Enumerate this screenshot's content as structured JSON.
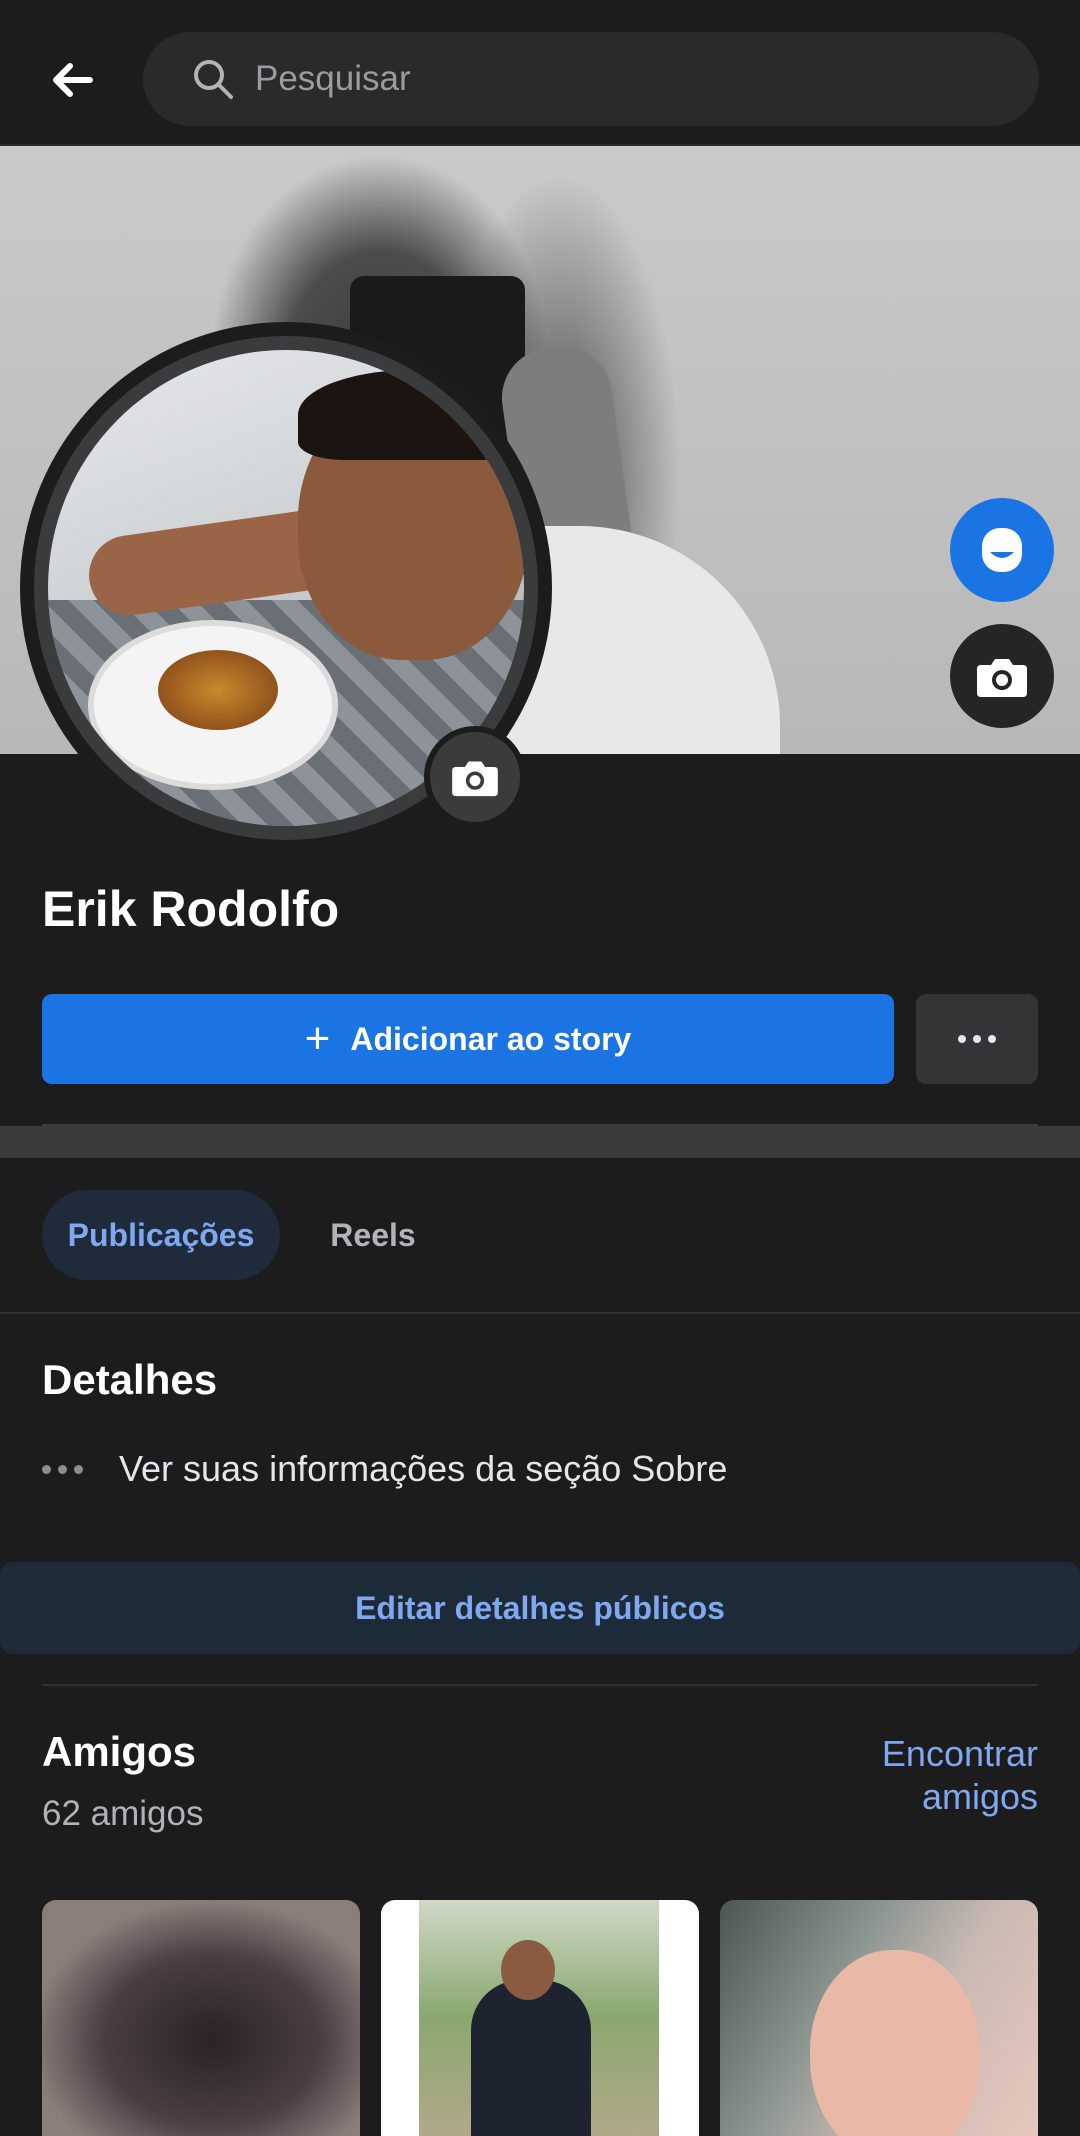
{
  "header": {
    "search_placeholder": "Pesquisar"
  },
  "profile": {
    "name": "Erik Rodolfo",
    "add_story_label": "Adicionar ao story"
  },
  "tabs": [
    {
      "label": "Publicações",
      "active": true
    },
    {
      "label": "Reels",
      "active": false
    }
  ],
  "details": {
    "title": "Detalhes",
    "about_link": "Ver suas informações da seção Sobre",
    "edit_button": "Editar detalhes públicos"
  },
  "friends": {
    "title": "Amigos",
    "count": "62 amigos",
    "find_label": "Encontrar amigos"
  },
  "colors": {
    "background": "#1c1c1d",
    "accent": "#1b74e4",
    "link": "#7fa8f0"
  },
  "icons": [
    "back-arrow-icon",
    "search-icon",
    "avatar-icon",
    "camera-icon",
    "plus-icon",
    "more-dots-icon"
  ]
}
